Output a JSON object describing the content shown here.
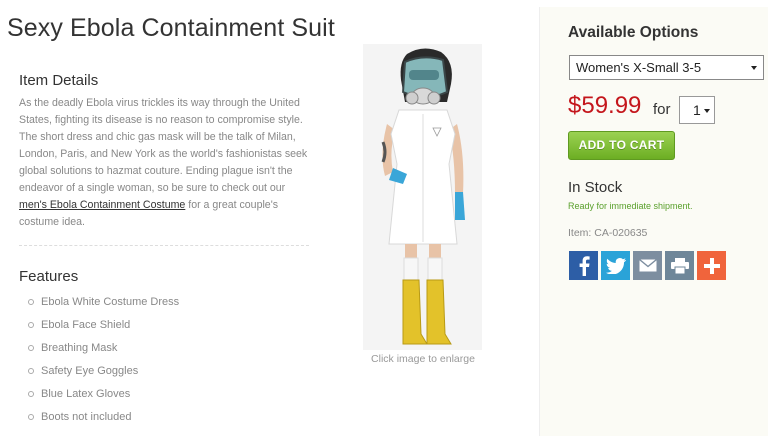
{
  "product": {
    "title": "Sexy Ebola Containment Suit"
  },
  "details": {
    "heading": "Item Details",
    "text_before_link": "As the deadly Ebola virus trickles its way through the United States, fighting its disease is no reason to compromise style. The short dress and chic gas mask will be the talk of Milan, London, Paris, and New York as the world's fashionistas seek global solutions to hazmat couture. Ending plague isn't the endeavor of a single woman, so be sure to check out our ",
    "link_text": "men's Ebola Containment Costume",
    "text_after_link": " for a great couple's costume idea."
  },
  "features": {
    "heading": "Features",
    "items": [
      "Ebola White Costume Dress",
      "Ebola Face Shield",
      "Breathing Mask",
      "Safety Eye Goggles",
      "Blue Latex Gloves",
      "Boots not included"
    ]
  },
  "image": {
    "caption": "Click image to enlarge"
  },
  "options": {
    "heading": "Available Options",
    "selected_size": "Women's X-Small 3-5",
    "price": "$59.99",
    "for_label": "for",
    "quantity": "1",
    "add_to_cart": "ADD TO CART",
    "stock_status": "In Stock",
    "stock_note": "Ready for immediate shipment.",
    "item_number": "Item: CA-020635"
  },
  "share": {
    "icons": [
      "facebook-icon",
      "twitter-icon",
      "email-icon",
      "print-icon",
      "plus-icon"
    ]
  },
  "colors": {
    "price": "#c4161c",
    "cart_button": "#7bbf2e",
    "stock_note": "#5aa02c"
  }
}
